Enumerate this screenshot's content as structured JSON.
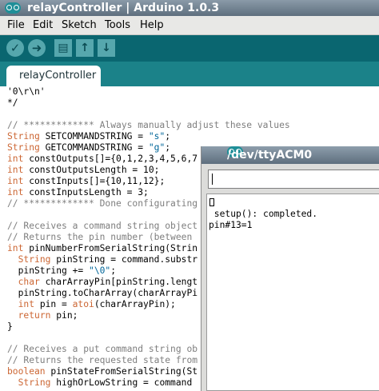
{
  "window": {
    "title": "relayController | Arduino 1.0.3"
  },
  "menu": {
    "items": [
      "File",
      "Edit",
      "Sketch",
      "Tools",
      "Help"
    ]
  },
  "toolbar": {
    "verify_icon": "checkmark-icon",
    "upload_icon": "arrow-right-icon",
    "new_icon": "new-file-icon",
    "open_icon": "arrow-up-icon",
    "save_icon": "arrow-down-icon",
    "verify_glyph": "✓",
    "upload_glyph": "➜",
    "new_glyph": "▤",
    "open_glyph": "↑",
    "save_glyph": "↓"
  },
  "tab": {
    "label": "relayController"
  },
  "code": {
    "lines": [
      "'0\\r\\n'",
      "*/",
      "",
      "// ************* Always manually adjust these values",
      "String SETCOMMANDSTRING = \"s\";",
      "String GETCOMMANDSTRING = \"g\";",
      "int constOutputs[]={0,1,2,3,4,5,6,7",
      "int constOutputsLength = 10;",
      "int constInputs[]={10,11,12};",
      "int constInputsLength = 3;",
      "// ************* Done configurating",
      "",
      "// Receives a command string object",
      "// Returns the pin number (between",
      "int pinNumberFromSerialString(Strin",
      "  String pinString = command.substr",
      "  pinString += \"\\0\";",
      "  char charArrayPin[pinString.lengt",
      "  pinString.toCharArray(charArrayPi",
      "  int pin = atoi(charArrayPin);",
      "  return pin;",
      "}",
      "",
      "// Receives a put command string ob",
      "// Returns the requested state from",
      "boolean pinStateFromSerialString(St",
      "  String highOrLowString = command"
    ]
  },
  "serial_monitor": {
    "title": "/dev/ttyACM0",
    "input_value": "",
    "output_lines": [
      " setup(): completed.",
      "pin#13=1"
    ]
  },
  "colors": {
    "toolbar_bg": "#0a6670",
    "tabstrip_bg": "#1b8289",
    "comment": "#7e7e7e",
    "keyword": "#cc6633",
    "string": "#006699"
  }
}
